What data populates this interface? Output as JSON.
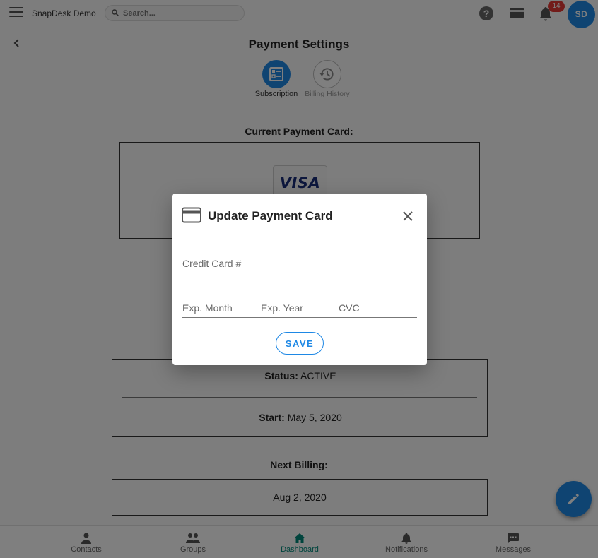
{
  "topbar": {
    "app_title": "SnapDesk Demo",
    "search_placeholder": "Search...",
    "notification_count": "14",
    "avatar_initials": "SD"
  },
  "header": {
    "title": "Payment Settings",
    "tabs": [
      {
        "label": "Subscription",
        "active": true,
        "icon": "checklist-icon"
      },
      {
        "label": "Billing History",
        "active": false,
        "icon": "history-icon"
      }
    ]
  },
  "content": {
    "current_card_label": "Current Payment Card:",
    "card_brand": "VISA",
    "status_label": "Status:",
    "status_value": "ACTIVE",
    "start_label": "Start:",
    "start_value": "May 5, 2020",
    "next_billing_label": "Next Billing:",
    "next_billing_value": "Aug 2, 2020"
  },
  "bottom_nav": {
    "items": [
      {
        "label": "Contacts",
        "icon": "person-icon",
        "active": false
      },
      {
        "label": "Groups",
        "icon": "groups-icon",
        "active": false
      },
      {
        "label": "Dashboard",
        "icon": "home-icon",
        "active": true
      },
      {
        "label": "Notifications",
        "icon": "bell-icon",
        "active": false
      },
      {
        "label": "Messages",
        "icon": "message-icon",
        "active": false
      }
    ]
  },
  "dialog": {
    "title": "Update Payment Card",
    "fields": {
      "credit_card_placeholder": "Credit Card #",
      "exp_month_placeholder": "Exp. Month",
      "exp_year_placeholder": "Exp. Year",
      "cvc_placeholder": "CVC"
    },
    "save_label": "SAVE"
  },
  "colors": {
    "accent": "#1e88e5",
    "badge": "#e53935",
    "nav_active": "#00897b"
  }
}
